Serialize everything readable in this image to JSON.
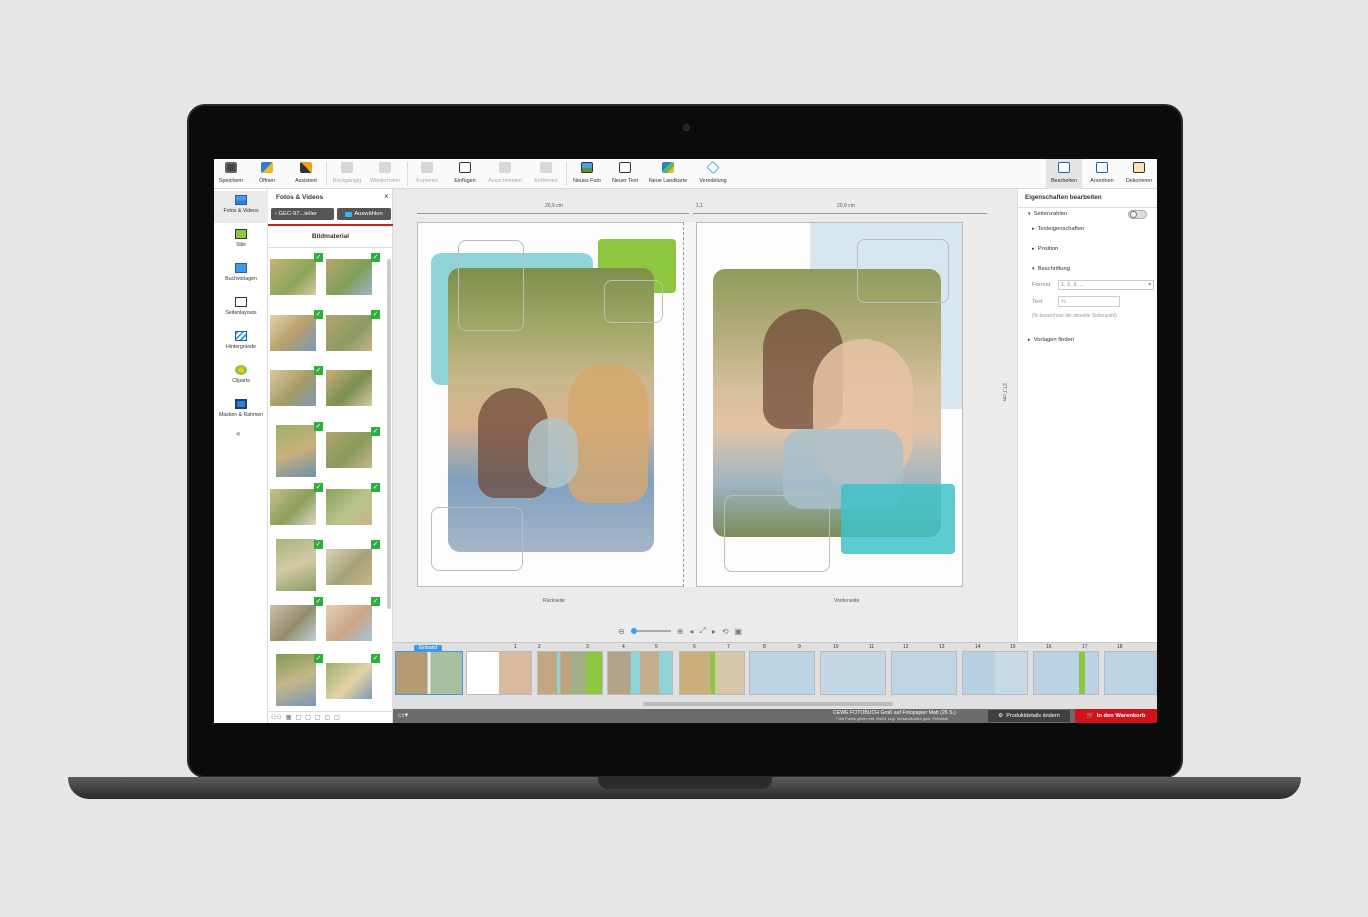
{
  "toolbar": {
    "save": "Speichern",
    "open": "Öffnen",
    "assistant": "Assistent",
    "undo": "Rückgängig",
    "redo": "Wiederholen",
    "copy": "Kopieren",
    "paste": "Einfügen",
    "cut": "Ausschneiden",
    "delete": "Entfernen",
    "new_photo": "Neues Foto",
    "new_text": "Neuer Text",
    "new_map": "Neue Landkarte",
    "refine": "Veredelung",
    "edit": "Bearbeiten",
    "arrange": "Anordnen",
    "decorate": "Dekorieren"
  },
  "leftnav": {
    "items": [
      {
        "label": "Fotos & Videos"
      },
      {
        "label": "Stile"
      },
      {
        "label": "Buchvorlagen"
      },
      {
        "label": "Seitenlayouts"
      },
      {
        "label": "Hintergründe"
      },
      {
        "label": "Cliparts"
      },
      {
        "label": "Masken & Rahmen"
      }
    ],
    "collapse": "«"
  },
  "panel": {
    "title": "Fotos & Videos",
    "close": "×",
    "back_label": "GEC-97...teller",
    "select_label": "Auswählen",
    "section_title": "Bildmaterial",
    "check": "✓"
  },
  "canvas": {
    "left_width": "20,9 cm",
    "spine_width": "1,1",
    "right_width": "20,9 cm",
    "height": "27,7 cm",
    "left_page": "Rückseite",
    "right_page": "Vorderseite"
  },
  "properties": {
    "title": "Eigenschaften bearbeiten",
    "page_numbers": "Seitenzahlen",
    "text_props": "Texteigenschaften",
    "position": "Position",
    "caption": "Beschriftung",
    "format_label": "Format",
    "format_value": "1, 2, 3, ...",
    "text_label": "Text",
    "text_value": "%",
    "hint": "(% bezeichnet die aktuelle Seitenzahl)",
    "find_templates": "Vorlagen finden"
  },
  "filmstrip": {
    "cover_label": "Einband",
    "page_numbers": [
      "1",
      "2",
      "3",
      "4",
      "5",
      "6",
      "7",
      "8",
      "9",
      "10",
      "11",
      "12",
      "13",
      "14",
      "15",
      "16",
      "17",
      "18"
    ]
  },
  "statusbar": {
    "product": "CEWE FOTOBUCH Groß auf Fotopapier Matt (26 S.)",
    "note": "* Die Preise gelten inkl. MwSt. zzgl. Versandkosten gem. Preisliste",
    "details_button": "Produktdetails ändern",
    "cart_button": "In den Warenkorb"
  },
  "colors": {
    "accent_red": "#d0121b",
    "check_green": "#2bb03b",
    "teal": "#8fd3d8",
    "green": "#8dc63f",
    "selection_blue": "#3d9be9"
  }
}
